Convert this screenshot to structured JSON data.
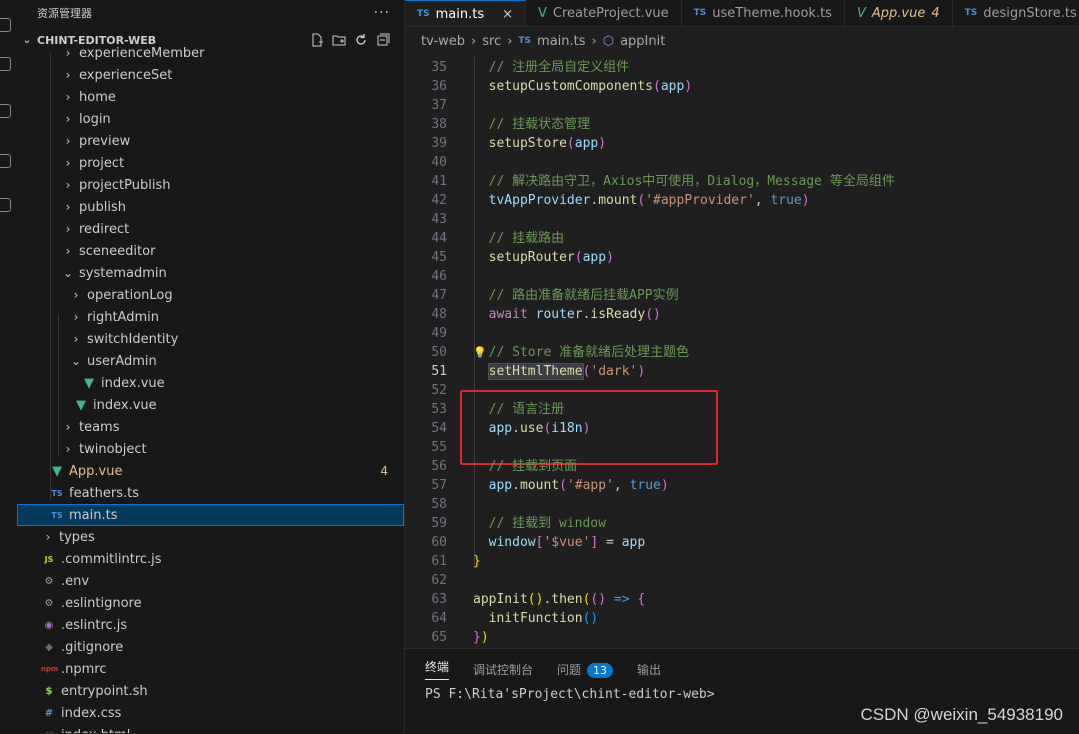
{
  "sidebar": {
    "title": "资源管理器",
    "more": "···",
    "project": "CHINT-EDITOR-WEB",
    "actions": [
      "new-file-icon",
      "new-folder-icon",
      "refresh-icon",
      "collapse-icon"
    ],
    "items": [
      {
        "label": "experienceMember",
        "kind": "folder",
        "open": false
      },
      {
        "label": "experienceSet",
        "kind": "folder",
        "open": false
      },
      {
        "label": "home",
        "kind": "folder",
        "open": false
      },
      {
        "label": "login",
        "kind": "folder",
        "open": false
      },
      {
        "label": "preview",
        "kind": "folder",
        "open": false
      },
      {
        "label": "project",
        "kind": "folder",
        "open": false
      },
      {
        "label": "projectPublish",
        "kind": "folder",
        "open": false
      },
      {
        "label": "publish",
        "kind": "folder",
        "open": false
      },
      {
        "label": "redirect",
        "kind": "folder",
        "open": false
      },
      {
        "label": "sceneeditor",
        "kind": "folder",
        "open": false
      },
      {
        "label": "systemadmin",
        "kind": "folder",
        "open": true
      },
      {
        "label": "operationLog",
        "kind": "folder",
        "open": false
      },
      {
        "label": "rightAdmin",
        "kind": "folder",
        "open": false
      },
      {
        "label": "switchIdentity",
        "kind": "folder",
        "open": false
      },
      {
        "label": "userAdmin",
        "kind": "folder",
        "open": true
      },
      {
        "label": "index.vue",
        "kind": "vue"
      },
      {
        "label": "index.vue",
        "kind": "vue"
      },
      {
        "label": "teams",
        "kind": "folder",
        "open": false
      },
      {
        "label": "twinobject",
        "kind": "folder",
        "open": false
      },
      {
        "label": "App.vue",
        "kind": "vue",
        "badge": "4"
      },
      {
        "label": "feathers.ts",
        "kind": "ts"
      },
      {
        "label": "main.ts",
        "kind": "ts"
      },
      {
        "label": "types",
        "kind": "folder",
        "open": false
      },
      {
        "label": ".commitlintrc.js",
        "kind": "js"
      },
      {
        "label": ".env",
        "kind": "gear"
      },
      {
        "label": ".eslintignore",
        "kind": "gear"
      },
      {
        "label": ".eslintrc.js",
        "kind": "lint"
      },
      {
        "label": ".gitignore",
        "kind": "git"
      },
      {
        "label": ".npmrc",
        "kind": "npm"
      },
      {
        "label": "entrypoint.sh",
        "kind": "sh"
      },
      {
        "label": "index.css",
        "kind": "css"
      },
      {
        "label": "index.html",
        "kind": "html"
      }
    ]
  },
  "tabs": [
    {
      "label": "main.ts",
      "icon": "TS",
      "active": true,
      "close": "×"
    },
    {
      "label": "CreateProject.vue",
      "icon": "V"
    },
    {
      "label": "useTheme.hook.ts",
      "icon": "TS"
    },
    {
      "label": "App.vue",
      "icon": "V",
      "badge": "4",
      "modified": true
    },
    {
      "label": "designStore.ts",
      "icon": "TS"
    }
  ],
  "breadcrumb": {
    "parts": [
      "tv-web",
      "src",
      "main.ts",
      "appInit"
    ],
    "icon_ts": "TS",
    "icon_fn": "⬡"
  },
  "code": {
    "current_line": 51,
    "lines": [
      {
        "n": "35",
        "tokens": [
          [
            "cmt",
            "  // 注册全局自定义组件"
          ]
        ]
      },
      {
        "n": "36",
        "tokens": [
          [
            "fn",
            "  setupCustomComponents"
          ],
          [
            "br2",
            "("
          ],
          [
            "var",
            "app"
          ],
          [
            "br2",
            ")"
          ]
        ]
      },
      {
        "n": "37",
        "tokens": []
      },
      {
        "n": "38",
        "tokens": [
          [
            "cmt",
            "  // 挂载状态管理"
          ]
        ]
      },
      {
        "n": "39",
        "tokens": [
          [
            "fn",
            "  setupStore"
          ],
          [
            "br2",
            "("
          ],
          [
            "var",
            "app"
          ],
          [
            "br2",
            ")"
          ]
        ]
      },
      {
        "n": "40",
        "tokens": []
      },
      {
        "n": "41",
        "tokens": [
          [
            "cmt",
            "  // 解决路由守卫，Axios中可使用，Dialog，Message 等全局组件"
          ]
        ]
      },
      {
        "n": "42",
        "tokens": [
          [
            "var",
            "  tvAppProvider"
          ],
          [
            "pn",
            "."
          ],
          [
            "fn",
            "mount"
          ],
          [
            "br2",
            "("
          ],
          [
            "str",
            "'#appProvider'"
          ],
          [
            "pn",
            ", "
          ],
          [
            "kw",
            "true"
          ],
          [
            "br2",
            ")"
          ]
        ]
      },
      {
        "n": "43",
        "tokens": []
      },
      {
        "n": "44",
        "tokens": [
          [
            "cmt",
            "  // 挂载路由"
          ]
        ]
      },
      {
        "n": "45",
        "tokens": [
          [
            "fn",
            "  setupRouter"
          ],
          [
            "br2",
            "("
          ],
          [
            "var",
            "app"
          ],
          [
            "br2",
            ")"
          ]
        ]
      },
      {
        "n": "46",
        "tokens": []
      },
      {
        "n": "47",
        "tokens": [
          [
            "cmt",
            "  // 路由准备就绪后挂载APP实例"
          ]
        ]
      },
      {
        "n": "48",
        "tokens": [
          [
            "ctl",
            "  await "
          ],
          [
            "var",
            "router"
          ],
          [
            "pn",
            "."
          ],
          [
            "fn",
            "isReady"
          ],
          [
            "br2",
            "()"
          ]
        ]
      },
      {
        "n": "49",
        "tokens": []
      },
      {
        "n": "50",
        "tokens": [
          [
            "cmt",
            "  // Store 准备就绪后处理主题色"
          ]
        ]
      },
      {
        "n": "51",
        "tokens": [
          [
            "pn",
            "  "
          ],
          [
            "fnhl",
            "setHtmlTheme"
          ],
          [
            "br2",
            "("
          ],
          [
            "str",
            "'dark'"
          ],
          [
            "br2",
            ")"
          ]
        ]
      },
      {
        "n": "52",
        "tokens": []
      },
      {
        "n": "53",
        "tokens": [
          [
            "cmt",
            "  // 语言注册"
          ]
        ]
      },
      {
        "n": "54",
        "tokens": [
          [
            "var",
            "  app"
          ],
          [
            "pn",
            "."
          ],
          [
            "fn",
            "use"
          ],
          [
            "br2",
            "("
          ],
          [
            "var",
            "i18n"
          ],
          [
            "br2",
            ")"
          ]
        ]
      },
      {
        "n": "55",
        "tokens": []
      },
      {
        "n": "56",
        "tokens": [
          [
            "cmt",
            "  // 挂载到页面"
          ]
        ]
      },
      {
        "n": "57",
        "tokens": [
          [
            "var",
            "  app"
          ],
          [
            "pn",
            "."
          ],
          [
            "fn",
            "mount"
          ],
          [
            "br2",
            "("
          ],
          [
            "str",
            "'#app'"
          ],
          [
            "pn",
            ", "
          ],
          [
            "kw",
            "true"
          ],
          [
            "br2",
            ")"
          ]
        ]
      },
      {
        "n": "58",
        "tokens": []
      },
      {
        "n": "59",
        "tokens": [
          [
            "cmt",
            "  // 挂载到 window"
          ]
        ]
      },
      {
        "n": "60",
        "tokens": [
          [
            "var",
            "  window"
          ],
          [
            "br2",
            "["
          ],
          [
            "str",
            "'$vue'"
          ],
          [
            "br2",
            "]"
          ],
          [
            "pn",
            " = "
          ],
          [
            "var",
            "app"
          ]
        ]
      },
      {
        "n": "61",
        "tokens": [
          [
            "br1",
            "}"
          ]
        ]
      },
      {
        "n": "62",
        "tokens": []
      },
      {
        "n": "63",
        "tokens": [
          [
            "fn",
            "appInit"
          ],
          [
            "br1",
            "()"
          ],
          [
            "pn",
            "."
          ],
          [
            "fn",
            "then"
          ],
          [
            "br1",
            "("
          ],
          [
            "br2",
            "()"
          ],
          [
            "kw",
            " => "
          ],
          [
            "br2",
            "{"
          ]
        ]
      },
      {
        "n": "64",
        "tokens": [
          [
            "fn",
            "  initFunction"
          ],
          [
            "br3",
            "()"
          ]
        ]
      },
      {
        "n": "65",
        "tokens": [
          [
            "br2",
            "}"
          ],
          [
            "br1",
            ")"
          ]
        ]
      }
    ]
  },
  "panel": {
    "tabs": [
      {
        "label": "终端",
        "active": true
      },
      {
        "label": "调试控制台"
      },
      {
        "label": "问题",
        "count": "13"
      },
      {
        "label": "输出"
      }
    ],
    "prompt": "PS F:\\Rita'sProject\\chint-editor-web>"
  },
  "watermark": "CSDN @weixin_54938190"
}
